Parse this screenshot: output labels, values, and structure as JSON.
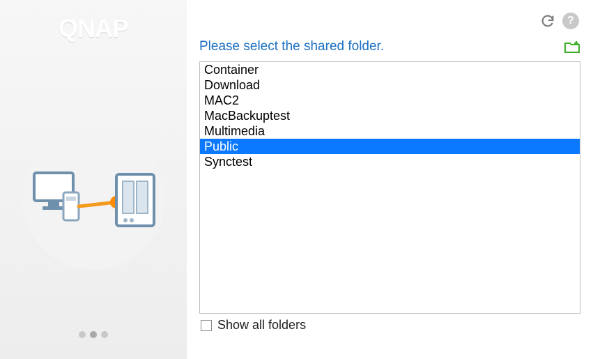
{
  "brand": {
    "logo_text": "QNAP"
  },
  "pager": {
    "total": 3,
    "active_index": 1
  },
  "header": {
    "instruction": "Please select the shared folder."
  },
  "icons": {
    "refresh": "refresh",
    "help": "?",
    "new_folder": "new-folder"
  },
  "folders": {
    "items": [
      {
        "name": "Container",
        "selected": false
      },
      {
        "name": "Download",
        "selected": false
      },
      {
        "name": "MAC2",
        "selected": false
      },
      {
        "name": "MacBackuptest",
        "selected": false
      },
      {
        "name": "Multimedia",
        "selected": false
      },
      {
        "name": "Public",
        "selected": true
      },
      {
        "name": "Synctest",
        "selected": false
      }
    ]
  },
  "show_all": {
    "checked": false,
    "label": "Show all folders"
  }
}
